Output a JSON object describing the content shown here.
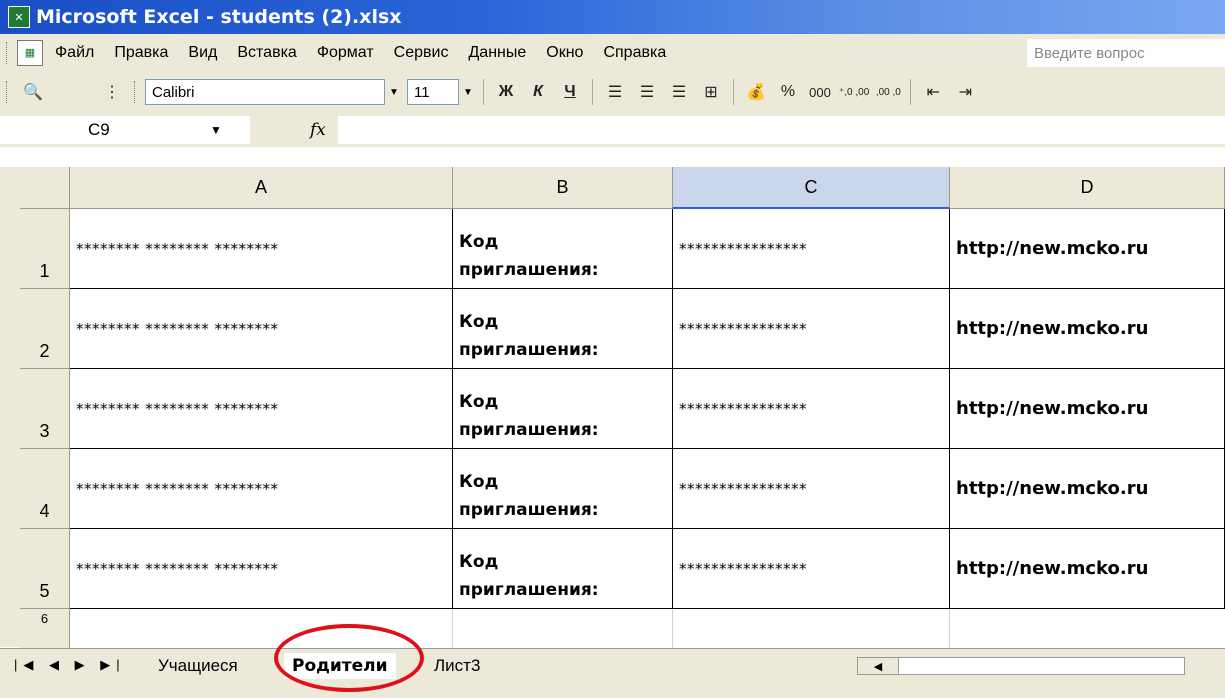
{
  "window": {
    "title": "Microsoft Excel - students (2).xlsx",
    "icon": "excel-icon"
  },
  "menu": {
    "items": [
      "Файл",
      "Правка",
      "Вид",
      "Вставка",
      "Формат",
      "Сервис",
      "Данные",
      "Окно",
      "Справка"
    ],
    "help_placeholder": "Введите вопрос"
  },
  "toolbar": {
    "font": "Calibri",
    "size": "11",
    "bold": "Ж",
    "italic": "К",
    "underline": "Ч",
    "percent": "%",
    "thousands": "000",
    "inc_decimal": "⁺,0 ,00",
    "dec_decimal": ",00 ,0"
  },
  "formula_bar": {
    "name_box": "C9",
    "fx": "fx",
    "formula": ""
  },
  "columns": [
    "A",
    "B",
    "C",
    "D"
  ],
  "rows": [
    {
      "num": "1",
      "a": "******** ******** ********",
      "b": "Код\nприглашения:",
      "c": "****************",
      "d": "http://new.mcko.ru"
    },
    {
      "num": "2",
      "a": "******** ******** ********",
      "b": "Код\nприглашения:",
      "c": "****************",
      "d": "http://new.mcko.ru"
    },
    {
      "num": "3",
      "a": "******** ******** ********",
      "b": "Код\nприглашения:",
      "c": "****************",
      "d": "http://new.mcko.ru"
    },
    {
      "num": "4",
      "a": "******** ******** ********",
      "b": "Код\nприглашения:",
      "c": "****************",
      "d": "http://new.mcko.ru"
    },
    {
      "num": "5",
      "a": "******** ******** ********",
      "b": "Код\nприглашения:",
      "c": "****************",
      "d": "http://new.mcko.ru"
    }
  ],
  "row6": "6",
  "sheets": {
    "tabs": [
      "Учащиеся",
      "Родители",
      "Лист3"
    ],
    "active": "Родители"
  },
  "colors": {
    "highlight": "#e0101a",
    "selected_column": "#c9d6ec",
    "title_bar": "#2a66d8"
  }
}
